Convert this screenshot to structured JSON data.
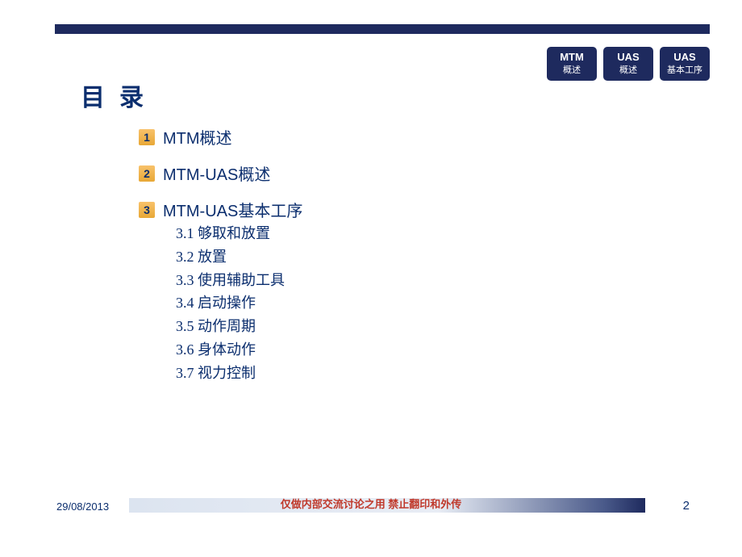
{
  "title": "目录",
  "tabs": [
    {
      "line1": "MTM",
      "line2": "概述"
    },
    {
      "line1": "UAS",
      "line2": "概述"
    },
    {
      "line1": "UAS",
      "line2": "基本工序"
    }
  ],
  "toc": [
    {
      "num": "1",
      "text": "MTM概述"
    },
    {
      "num": "2",
      "text": "MTM-UAS概述"
    },
    {
      "num": "3",
      "text": "MTM-UAS基本工序"
    }
  ],
  "subitems": [
    "3.1 够取和放置",
    "3.2 放置",
    "3.3 使用辅助工具",
    "3.4 启动操作",
    "3.5 动作周期",
    "3.6 身体动作",
    "3.7 视力控制"
  ],
  "footer": {
    "date": "29/08/2013",
    "notice": "仅做内部交流讨论之用  禁止翻印和外传",
    "page": "2"
  }
}
